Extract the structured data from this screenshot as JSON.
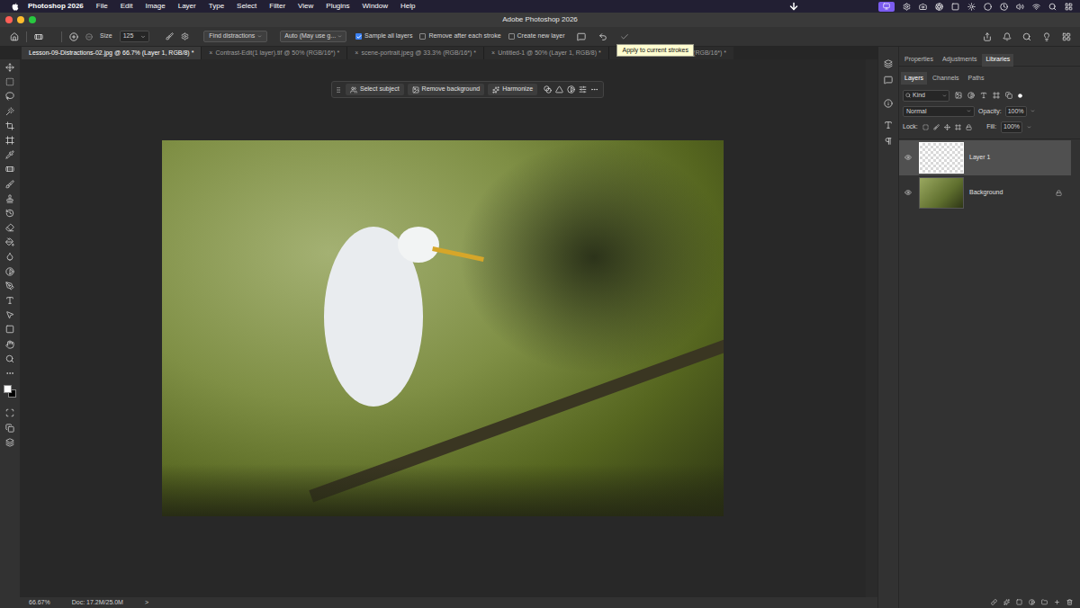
{
  "menubar": {
    "app": "Photoshop 2026",
    "items": [
      "File",
      "Edit",
      "Image",
      "Layer",
      "Type",
      "Select",
      "Filter",
      "View",
      "Plugins",
      "Window",
      "Help"
    ]
  },
  "window": {
    "title": "Adobe Photoshop 2026"
  },
  "options_bar": {
    "size_label": "Size",
    "size_value": "125",
    "find_button": "Find distractions",
    "mode": "Auto (May use g...",
    "checkboxes": [
      {
        "label": "Sample all layers",
        "checked": true
      },
      {
        "label": "Remove after each stroke",
        "checked": false
      },
      {
        "label": "Create new layer",
        "checked": false
      }
    ],
    "tooltip": "Apply to current strokes"
  },
  "tabs": [
    {
      "label": "Lesson-09-Distractions-02.jpg @ 66.7% (Layer 1, RGB/8) *",
      "selected": true
    },
    {
      "label": "Contrast-Edit(1 layer).tif @ 50% (RGB/16*) *",
      "selected": false,
      "close": "×"
    },
    {
      "label": "scene-portrait.jpeg @ 33.3% (RGB/16*) *",
      "selected": false,
      "close": "×"
    },
    {
      "label": "Untitled-1 @ 50% (Layer 1, RGB/8) *",
      "selected": false,
      "close": "×"
    },
    {
      "label": "Light-Shape-.jpg @ 50% (RGB/16*) *",
      "selected": false,
      "close": "×"
    }
  ],
  "task_bar": {
    "buttons": [
      "Select subject",
      "Remove background",
      "Harmonize"
    ]
  },
  "panel_tabs": [
    {
      "label": "Properties",
      "selected": false
    },
    {
      "label": "Adjustments",
      "selected": false
    },
    {
      "label": "Libraries",
      "selected": true
    }
  ],
  "layers_panel": {
    "tabs": [
      {
        "label": "Layers",
        "selected": true
      },
      {
        "label": "Channels",
        "selected": false
      },
      {
        "label": "Paths",
        "selected": false
      }
    ],
    "filter": "Kind",
    "blend_mode": "Normal",
    "opacity_label": "Opacity:",
    "opacity": "100%",
    "lock_label": "Lock:",
    "fill_label": "Fill:",
    "fill": "100%",
    "layers": [
      {
        "name": "Layer 1",
        "selected": true,
        "visible": true,
        "locked": false,
        "kind": "transparent"
      },
      {
        "name": "Background",
        "selected": false,
        "visible": true,
        "locked": true,
        "kind": "image"
      }
    ]
  },
  "status_bar": {
    "zoom": "66.67%",
    "doc": "Doc: 17.2M/25.0M",
    "arrow": ">"
  }
}
